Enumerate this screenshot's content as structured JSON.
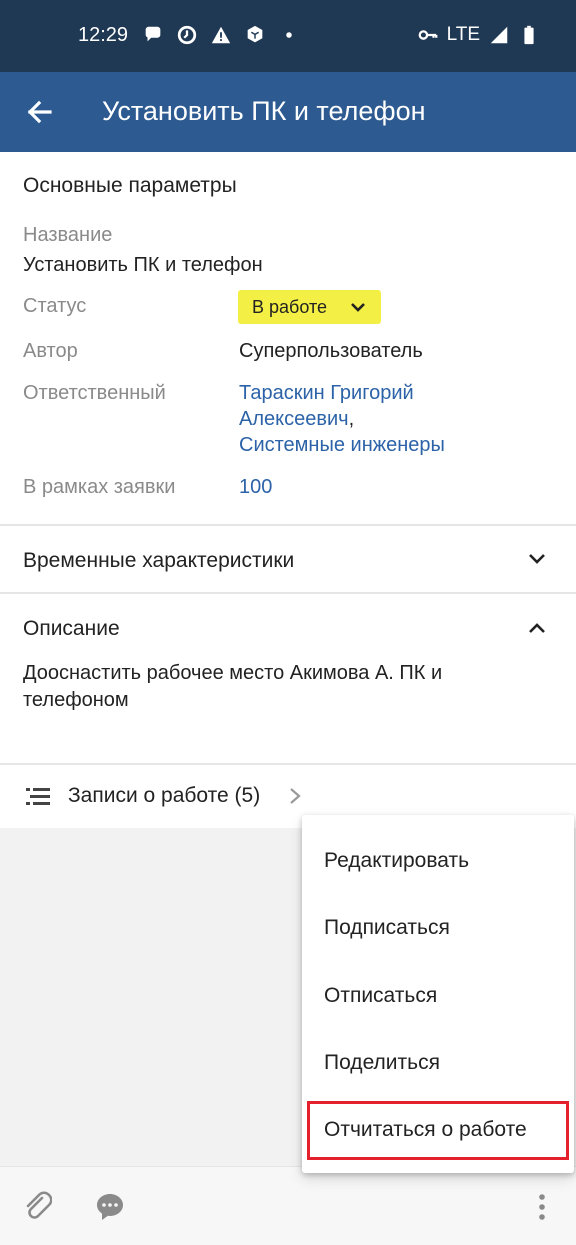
{
  "status_bar": {
    "time": "12:29",
    "network": "LTE",
    "icons_left": [
      "chat-bubble-icon",
      "clock-icon",
      "warning-icon",
      "shield-icon",
      "dot-icon"
    ],
    "icons_right": [
      "key-icon",
      "signal-icon",
      "battery-icon"
    ]
  },
  "app_bar": {
    "title": "Установить ПК и телефон",
    "back_icon": "arrow-left-icon",
    "color": "#2c5a91"
  },
  "main_params": {
    "section_title": "Основные параметры",
    "name_label": "Название",
    "name_value": "Установить ПК и телефон",
    "status_label": "Статус",
    "status_value": "В работе",
    "status_color": "#f4ef45",
    "author_label": "Автор",
    "author_value": "Суперпользователь",
    "responsible_label": "Ответственный",
    "responsible_line1": "Тараскин Григорий",
    "responsible_line2": "Алексеевич",
    "responsible_comma": ",",
    "responsible_line3": "Системные инженеры",
    "request_label": "В рамках заявки",
    "request_value": "100"
  },
  "time_section": {
    "title": "Временные характеристики"
  },
  "description": {
    "title": "Описание",
    "text_line1": "Дооснастить рабочее место Акимова А. ПК и",
    "text_line2": "телефоном"
  },
  "work_records": {
    "label": "Записи о работе (5)"
  },
  "menu": {
    "items": [
      "Редактировать",
      "Подписаться",
      "Отписаться",
      "Поделиться",
      "Отчитаться о работе"
    ],
    "highlighted_item": "Отчитаться о работе",
    "highlight_color": "#e3202b"
  },
  "bottom_bar": {
    "icons": [
      "paperclip-icon",
      "comment-icon",
      "more-vertical-icon"
    ]
  }
}
